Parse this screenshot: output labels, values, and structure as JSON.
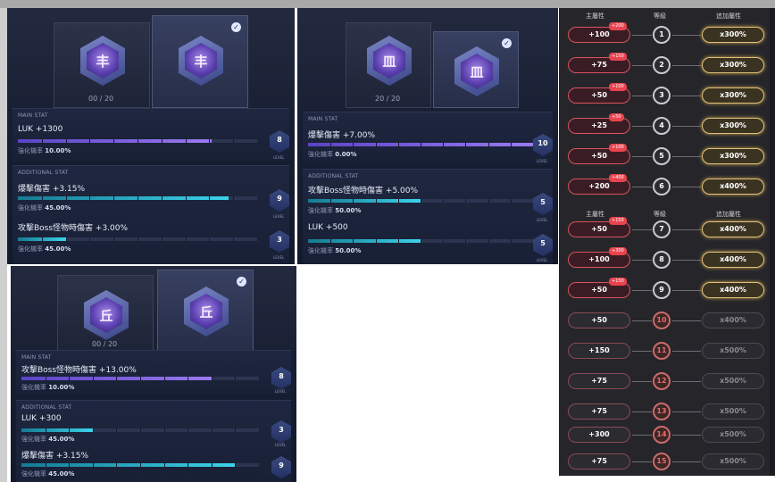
{
  "panels": [
    {
      "id": "p1",
      "gem_glyph": "丰",
      "slot_count": "00 / 20",
      "main": {
        "title": "MAIN STAT",
        "stat": "LUK +1300",
        "rate_label": "強化機率",
        "rate": "10.00%",
        "fill": 0.81,
        "level": "8"
      },
      "additional_title": "ADDITIONAL STAT",
      "additional": [
        {
          "stat": "爆擊傷害 +3.15%",
          "rate_label": "強化機率",
          "rate": "45.00%",
          "fill": 0.88,
          "level": "9"
        },
        {
          "stat": "攻擊Boss怪物時傷害 +3.00%",
          "rate_label": "強化機率",
          "rate": "45.00%",
          "fill": 0.2,
          "level": "3"
        }
      ],
      "level_word": "LEVEL"
    },
    {
      "id": "p2",
      "gem_glyph": "皿",
      "slot_count": "20 / 20",
      "main": {
        "title": "MAIN STAT",
        "stat": "爆擊傷害 +7.00%",
        "rate_label": "強化機率",
        "rate": "0.00%",
        "fill": 1.0,
        "level": "10"
      },
      "additional_title": "ADDITIONAL STAT",
      "additional": [
        {
          "stat": "攻擊Boss怪物時傷害 +5.00%",
          "rate_label": "強化機率",
          "rate": "50.00%",
          "fill": 0.5,
          "level": "5"
        },
        {
          "stat": "LUK +500",
          "rate_label": "強化機率",
          "rate": "50.00%",
          "fill": 0.5,
          "level": "5"
        }
      ],
      "level_word": "LEVEL"
    },
    {
      "id": "p3",
      "gem_glyph": "丘",
      "slot_count": "00 / 20",
      "main": {
        "title": "MAIN STAT",
        "stat": "攻擊Boss怪物時傷害 +13.00%",
        "rate_label": "強化機率",
        "rate": "10.00%",
        "fill": 0.8,
        "level": "8"
      },
      "additional_title": "ADDITIONAL STAT",
      "additional": [
        {
          "stat": "LUK +300",
          "rate_label": "強化機率",
          "rate": "45.00%",
          "fill": 0.3,
          "level": "3"
        },
        {
          "stat": "爆擊傷害 +3.15%",
          "rate_label": "強化機率",
          "rate": "45.00%",
          "fill": 0.9,
          "level": "9"
        }
      ],
      "level_word": "LEVEL"
    }
  ],
  "table": {
    "headers": {
      "main": "主屬性",
      "level": "等級",
      "additional": "追加屬性"
    },
    "rows": [
      {
        "main": "+100",
        "tag": "+200",
        "level": "1",
        "add": "x300%",
        "active": true
      },
      {
        "main": "+75",
        "tag": "+150",
        "level": "2",
        "add": "x300%",
        "active": true
      },
      {
        "main": "+50",
        "tag": "+100",
        "level": "3",
        "add": "x300%",
        "active": true
      },
      {
        "main": "+25",
        "tag": "+50",
        "level": "4",
        "add": "x300%",
        "active": true
      },
      {
        "main": "+50",
        "tag": "+100",
        "level": "5",
        "add": "x300%",
        "active": true
      },
      {
        "main": "+200",
        "tag": "+400",
        "level": "6",
        "add": "x400%",
        "active": true
      },
      {
        "main": "+50",
        "tag": "+150",
        "level": "7",
        "add": "x400%",
        "active": true
      },
      {
        "main": "+100",
        "tag": "+300",
        "level": "8",
        "add": "x400%",
        "active": true
      },
      {
        "main": "+50",
        "tag": "+150",
        "level": "9",
        "add": "x400%",
        "active": true
      },
      {
        "main": "+50",
        "tag": "",
        "level": "10",
        "add": "x400%",
        "active": false
      },
      {
        "main": "+150",
        "tag": "",
        "level": "11",
        "add": "x500%",
        "active": false
      },
      {
        "main": "+75",
        "tag": "",
        "level": "12",
        "add": "x500%",
        "active": false
      },
      {
        "main": "+75",
        "tag": "",
        "level": "13",
        "add": "x500%",
        "active": false
      },
      {
        "main": "+300",
        "tag": "",
        "level": "14",
        "add": "x500%",
        "active": false
      },
      {
        "main": "+75",
        "tag": "",
        "level": "15",
        "add": "x500%",
        "active": false
      }
    ]
  }
}
